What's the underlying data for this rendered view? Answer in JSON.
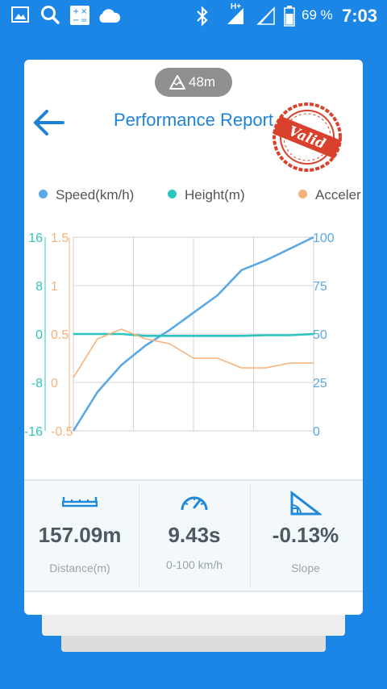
{
  "status_bar": {
    "battery": "69 %",
    "time": "7:03",
    "network": "H+",
    "icons": [
      "image-icon",
      "search-icon",
      "calculator-icon",
      "cloud-icon",
      "bluetooth-icon",
      "signal-icon",
      "battery-icon"
    ]
  },
  "header": {
    "altitude": "48m",
    "title": "Performance Report",
    "stamp": "Valid"
  },
  "colors": {
    "primary": "#1b86e6",
    "speed": "#5aa9e6",
    "height": "#2cc4c0",
    "acceleration": "#f5b27a",
    "stamp": "#d9412d",
    "text_dark": "#4d5961"
  },
  "legend": [
    {
      "label": "Speed(km/h)",
      "color": "#5aa9e6"
    },
    {
      "label": "Height(m)",
      "color": "#2cc4c0"
    },
    {
      "label": "Acceler",
      "color": "#f5b27a"
    }
  ],
  "chart_data": {
    "type": "line",
    "grid": true,
    "x": [
      0,
      0.1,
      0.2,
      0.3,
      0.4,
      0.5,
      0.6,
      0.7,
      0.8,
      0.9,
      1.0
    ],
    "axes": {
      "height_ticks": [
        "16",
        "8",
        "0",
        "-8",
        "-16"
      ],
      "height_range": [
        -16,
        16
      ],
      "accel_ticks": [
        "1.5",
        "1",
        "0.5",
        "0",
        "-0.5"
      ],
      "accel_range": [
        -0.5,
        1.5
      ],
      "speed_ticks": [
        "100",
        "75",
        "50",
        "25",
        "0"
      ],
      "speed_range": [
        0,
        100
      ]
    },
    "series": [
      {
        "name": "Speed(km/h)",
        "axis": "speed",
        "values": [
          0,
          20,
          34,
          44,
          52,
          61,
          70,
          83,
          88,
          94,
          100
        ]
      },
      {
        "name": "Height(m)",
        "axis": "height",
        "values": [
          0,
          0,
          0,
          -0.3,
          -0.3,
          -0.3,
          -0.3,
          -0.3,
          -0.2,
          -0.2,
          0
        ]
      },
      {
        "name": "Acceler",
        "axis": "accel",
        "values": [
          0.05,
          0.45,
          0.55,
          0.45,
          0.4,
          0.25,
          0.25,
          0.15,
          0.15,
          0.2,
          0.2
        ]
      }
    ]
  },
  "stats": [
    {
      "icon": "ruler-icon",
      "value": "157.09m",
      "label": "Distance(m)"
    },
    {
      "icon": "speedometer-icon",
      "value": "9.43s",
      "label": "0-100 km/h"
    },
    {
      "icon": "slope-icon",
      "value": "-0.13%",
      "label": "Slope"
    }
  ]
}
